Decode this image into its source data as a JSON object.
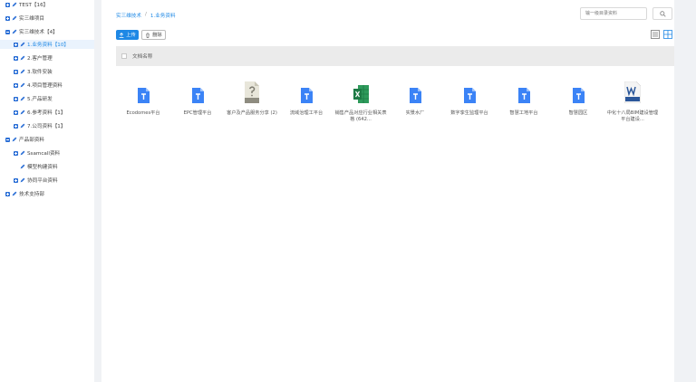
{
  "sidebar": {
    "items": [
      {
        "label": "TEST【16】",
        "toggle": "expand"
      },
      {
        "label": "实三维项目",
        "toggle": "expand"
      },
      {
        "label": "实三维技术【4】",
        "toggle": "collapse"
      },
      {
        "label": "1.业务资料【10】",
        "toggle": "expand",
        "active": true
      },
      {
        "label": "2.客户管理",
        "toggle": "expand"
      },
      {
        "label": "3.软件安装",
        "toggle": "expand"
      },
      {
        "label": "4.项目管理资料",
        "toggle": "expand"
      },
      {
        "label": "5.产品研发",
        "toggle": "expand"
      },
      {
        "label": "6.参考资料【1】",
        "toggle": "expand"
      },
      {
        "label": "7.公司资料【1】",
        "toggle": "expand"
      },
      {
        "label": "产品部资料",
        "toggle": "collapse"
      },
      {
        "label": "Ssamcall资料",
        "toggle": "expand"
      },
      {
        "label": "模型构建资料",
        "toggle": "none"
      },
      {
        "label": "协同平台资料",
        "toggle": "expand"
      },
      {
        "label": "技术支持部",
        "toggle": "expand"
      }
    ]
  },
  "breadcrumb": {
    "root": "实三维技术",
    "separator": "/",
    "current": "1.业务资料"
  },
  "search": {
    "placeholder": "输一级目录资料"
  },
  "toolbar": {
    "upload_label": "上传",
    "delete_label": "删除"
  },
  "list": {
    "header_label": "文档名称"
  },
  "files": [
    {
      "name": "Ecodomes平台",
      "type": "doc-blue"
    },
    {
      "name": "EPC管理平台",
      "type": "doc-blue"
    },
    {
      "name": "客户及产品服务分享 (2)",
      "type": "unknown"
    },
    {
      "name": "流域治理工平台",
      "type": "doc-blue"
    },
    {
      "name": "销售产品对应行业相关表格 (642...",
      "type": "excel"
    },
    {
      "name": "实景水厂",
      "type": "doc-blue"
    },
    {
      "name": "数字孪生监理平台",
      "type": "doc-blue"
    },
    {
      "name": "智慧工地平台",
      "type": "doc-blue"
    },
    {
      "name": "智慧园区",
      "type": "doc-blue"
    },
    {
      "name": "中化十八局BIM建设管理平台建设...",
      "type": "word"
    }
  ],
  "colors": {
    "accent": "#1e88e5",
    "active_bg": "#eaf3fd",
    "doc_blue": "#3b83f6",
    "excel_green": "#1d7a45",
    "word_blue": "#2b579a"
  }
}
